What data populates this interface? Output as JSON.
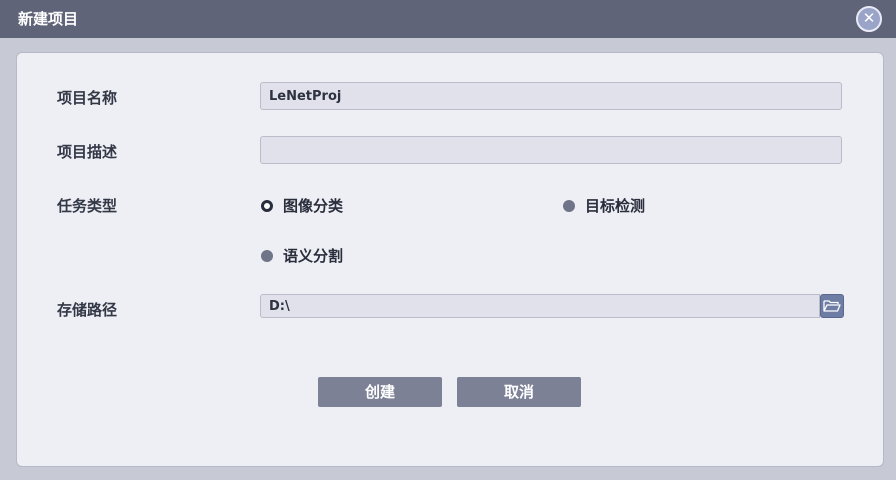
{
  "window": {
    "title": "新建项目"
  },
  "form": {
    "name_label": "项目名称",
    "name_value": "LeNetProj",
    "desc_label": "项目描述",
    "desc_value": "",
    "task_label": "任务类型",
    "task_options": [
      {
        "label": "图像分类",
        "checked": true
      },
      {
        "label": "目标检测",
        "checked": false
      },
      {
        "label": "语义分割",
        "checked": false
      }
    ],
    "path_label": "存储路径",
    "path_value": "D:\\"
  },
  "buttons": {
    "create": "创建",
    "cancel": "取消"
  },
  "icons": {
    "close": "close-icon",
    "browse": "folder-open-icon"
  },
  "colors": {
    "titlebar": "#5f6478",
    "panel": "#eeeff4",
    "button": "#7c8196",
    "browse": "#6e7da4"
  }
}
